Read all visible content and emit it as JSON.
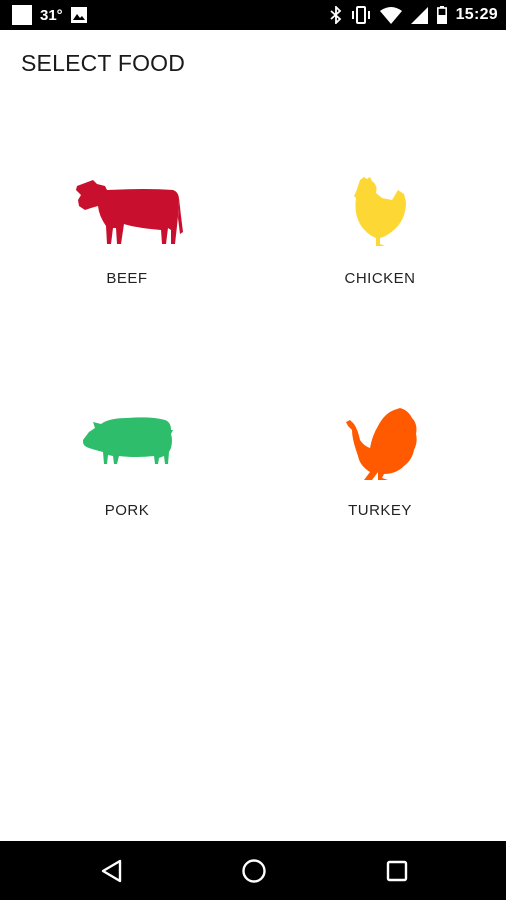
{
  "status_bar": {
    "temperature": "31°",
    "time": "15:29",
    "icons": [
      "notification-square-icon",
      "image-notification-icon",
      "bluetooth-icon",
      "vibrate-icon",
      "wifi-icon",
      "signal-icon",
      "battery-icon"
    ]
  },
  "page": {
    "title": "SELECT FOOD"
  },
  "foods": [
    {
      "label": "BEEF",
      "icon": "cow-icon",
      "color": "#C8102E"
    },
    {
      "label": "CHICKEN",
      "icon": "chicken-icon",
      "color": "#FDD835"
    },
    {
      "label": "PORK",
      "icon": "pig-icon",
      "color": "#2EBD6B"
    },
    {
      "label": "TURKEY",
      "icon": "turkey-icon",
      "color": "#FF5A00"
    }
  ],
  "nav_bar": {
    "buttons": [
      "back-icon",
      "home-icon",
      "recents-icon"
    ]
  }
}
